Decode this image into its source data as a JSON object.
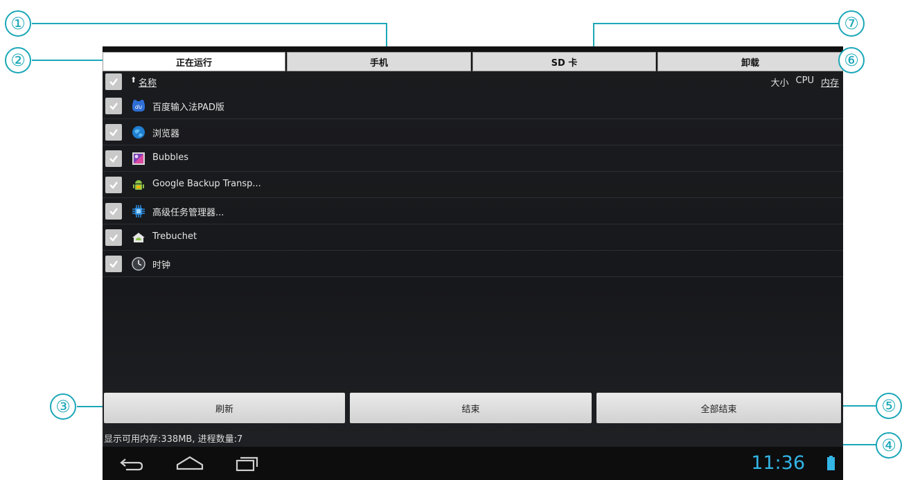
{
  "tabs": [
    {
      "label": "正在运行",
      "active": true
    },
    {
      "label": "手机",
      "active": false
    },
    {
      "label": "SD 卡",
      "active": false
    },
    {
      "label": "卸载",
      "active": false
    }
  ],
  "list_header": {
    "name_label": "名称",
    "sort_arrow": "⬆",
    "col_size": "大小",
    "col_cpu": "CPU",
    "col_memory": "内存"
  },
  "apps": [
    {
      "label": "百度输入法PAD版",
      "icon": "baidu-input-icon",
      "checked": true
    },
    {
      "label": "浏览器",
      "icon": "browser-globe-icon",
      "checked": true
    },
    {
      "label": "Bubbles",
      "icon": "bubbles-icon",
      "checked": true
    },
    {
      "label": "Google Backup Transp...",
      "icon": "android-robot-icon",
      "checked": true
    },
    {
      "label": "高级任务管理器...",
      "icon": "task-manager-icon",
      "checked": true
    },
    {
      "label": "Trebuchet",
      "icon": "trebuchet-home-icon",
      "checked": true
    },
    {
      "label": "时钟",
      "icon": "clock-icon",
      "checked": true
    }
  ],
  "buttons": {
    "refresh": "刷新",
    "end": "结束",
    "end_all": "全部结束"
  },
  "status_text": "显示可用内存:338MB, 进程数量:7",
  "navbar": {
    "time": "11:36",
    "accent": "#33b5e5"
  },
  "callouts": [
    "①",
    "②",
    "③",
    "④",
    "⑤",
    "⑥",
    "⑦"
  ],
  "callout_color": "#1aa7b8"
}
